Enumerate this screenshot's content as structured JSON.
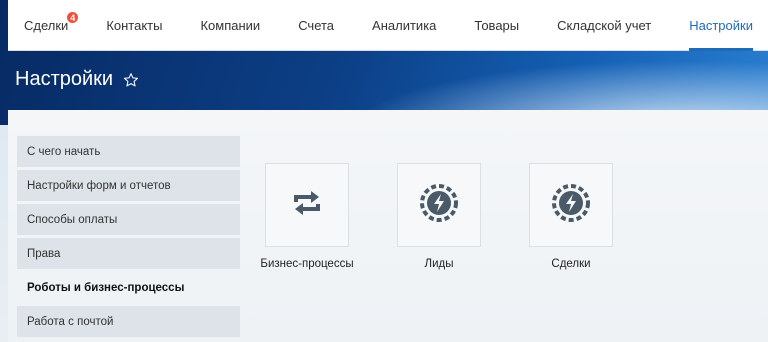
{
  "nav": {
    "tabs": [
      {
        "label": "Сделки",
        "badge": "4"
      },
      {
        "label": "Контакты"
      },
      {
        "label": "Компании"
      },
      {
        "label": "Счета"
      },
      {
        "label": "Аналитика"
      },
      {
        "label": "Товары"
      },
      {
        "label": "Складской учет"
      },
      {
        "label": "Настройки",
        "active": true
      }
    ]
  },
  "header": {
    "title": "Настройки",
    "favorite_icon": "star-outline-icon"
  },
  "sidebar": {
    "items": [
      {
        "label": "С чего начать"
      },
      {
        "label": "Настройки форм и отчетов"
      },
      {
        "label": "Способы оплаты"
      },
      {
        "label": "Права"
      },
      {
        "label": "Роботы и бизнес-процессы",
        "active": true
      },
      {
        "label": "Работа с почтой"
      }
    ]
  },
  "tiles": [
    {
      "label": "Бизнес-процессы",
      "icon": "refresh-arrows-icon"
    },
    {
      "label": "Лиды",
      "icon": "robot-gear-icon"
    },
    {
      "label": "Сделки",
      "icon": "robot-gear-icon"
    }
  ],
  "colors": {
    "accent": "#1e6bb8",
    "badge": "#f0503a",
    "icon": "#4a5a68"
  }
}
